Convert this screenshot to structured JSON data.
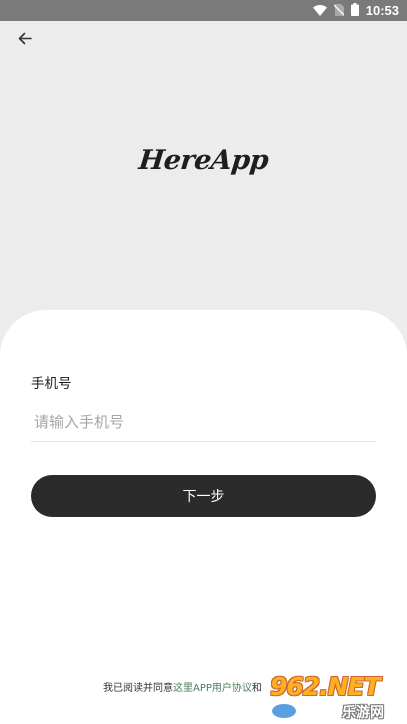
{
  "status_bar": {
    "time": "10:53",
    "icons": [
      "wifi-icon",
      "no-sim-icon",
      "battery-icon"
    ]
  },
  "header": {
    "back_icon": "arrow-left-icon"
  },
  "logo": {
    "text": "HereApp"
  },
  "form": {
    "phone_label": "手机号",
    "phone_placeholder": "请输入手机号",
    "phone_value": "",
    "next_label": "下一步"
  },
  "agreement": {
    "prefix": "我已阅读并同意",
    "link_text": "这里APP用户协议",
    "suffix": "和"
  },
  "watermark": {
    "text": "962.NET",
    "sub": "乐游网"
  },
  "colors": {
    "background": "#ececec",
    "card": "#ffffff",
    "button": "#2b2b2b",
    "link": "#4a7c59",
    "status_bar": "#7a7a7a"
  }
}
